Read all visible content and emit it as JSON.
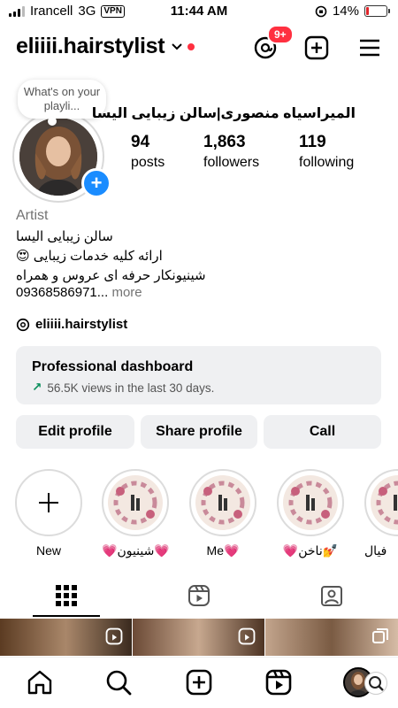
{
  "status": {
    "carrier": "Irancell",
    "network": "3G",
    "vpn": "VPN",
    "time": "11:44 AM",
    "battery": "14%"
  },
  "header": {
    "username": "eliiii.hairstylist",
    "threads_badge": "9+"
  },
  "note": {
    "text": "What's on your playli..."
  },
  "profile": {
    "full_name": "المیراسیاه منصوری|سالن زیبایی الیسا",
    "stats": [
      {
        "value": "94",
        "label": "posts"
      },
      {
        "value": "1,863",
        "label": "followers"
      },
      {
        "value": "119",
        "label": "following"
      }
    ],
    "category": "Artist",
    "bio": [
      "سالن زیبایی الیسا",
      "ارائه کلیه خدمات زیبایی 😍",
      "شینیونکار حرفه ای عروس و همراه"
    ],
    "phone": "09368586971...",
    "more": " more",
    "threads_handle": "eliiii.hairstylist"
  },
  "dashboard": {
    "title": "Professional dashboard",
    "arrow": "↗",
    "subtitle": "56.5K views in the last 30 days."
  },
  "buttons": {
    "edit": "Edit profile",
    "share": "Share profile",
    "call": "Call"
  },
  "highlights": [
    {
      "label": "New",
      "kind": "new"
    },
    {
      "label": "💗شینیون💗",
      "kind": "cover"
    },
    {
      "label": "Me💗",
      "kind": "cover"
    },
    {
      "label": "💗ناخن💅",
      "kind": "cover"
    },
    {
      "label": "فیال",
      "kind": "cover"
    }
  ],
  "tabs": [
    "grid-icon",
    "reels-icon",
    "tagged-icon"
  ],
  "nav": [
    "home-icon",
    "search-icon",
    "create-icon",
    "reels-icon",
    "profile-avatar"
  ],
  "colors": {
    "accent": "#1a8cff",
    "badge": "#ff3040",
    "trend": "#0a8f5b",
    "button_bg": "#eff0f2"
  }
}
